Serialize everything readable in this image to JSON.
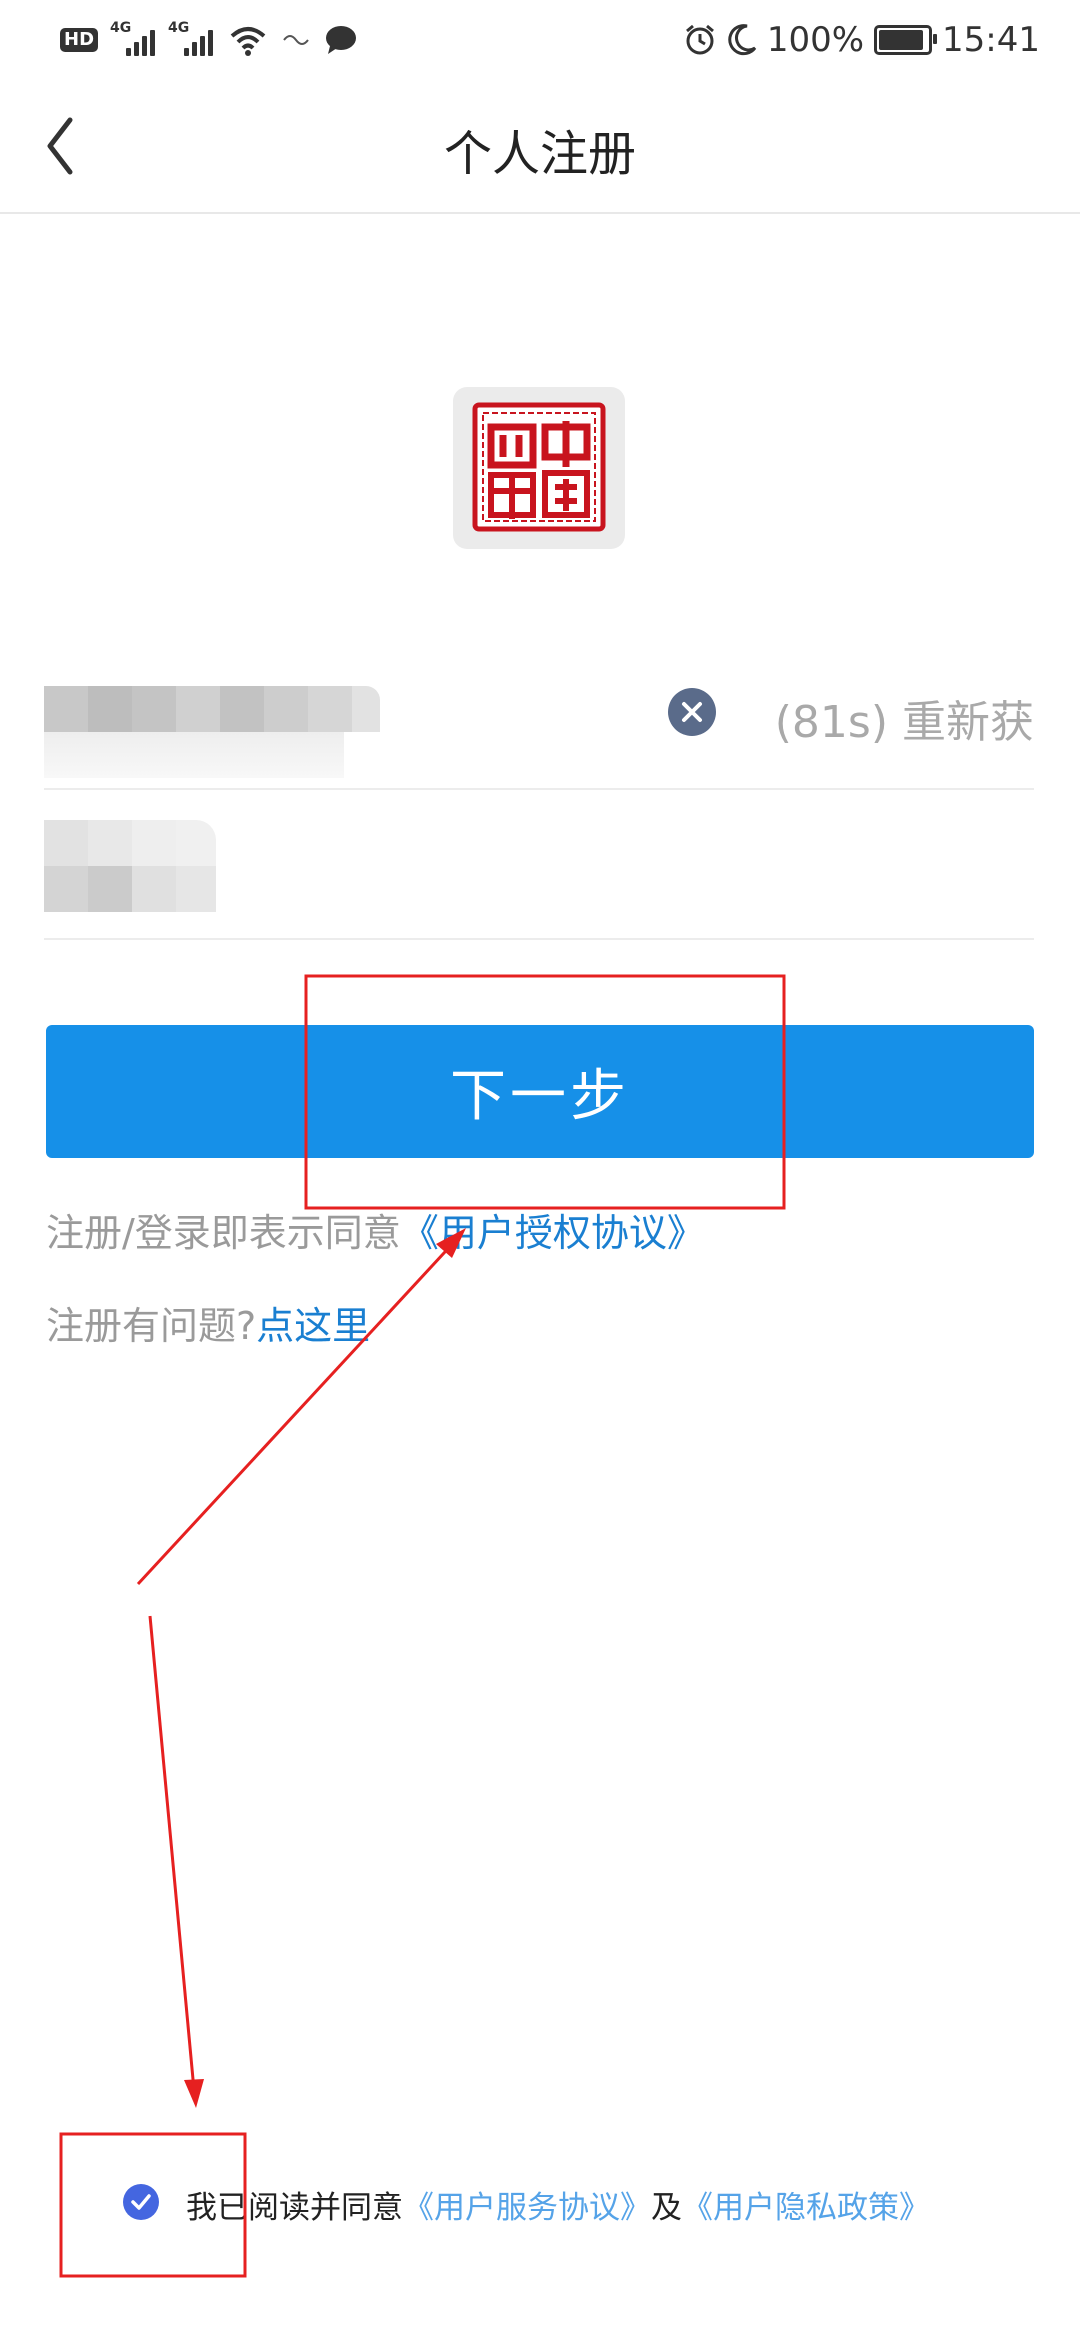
{
  "status_bar": {
    "left_badges": [
      "HD",
      "4G",
      "4G"
    ],
    "icons": [
      "hd-icon",
      "signal-icon",
      "signal-icon",
      "wifi-icon",
      "sync-icon",
      "message-icon"
    ],
    "battery_text": "100%",
    "battery_level": 1.0,
    "right_icons": [
      "alarm-icon",
      "moon-icon",
      "battery-icon"
    ],
    "time": "15:41"
  },
  "header": {
    "title": "个人注册",
    "back_icon": "chevron-left-icon"
  },
  "logo": {
    "description_icon": "red-seal-logo",
    "accent": "#c8141e",
    "text": "中國四東"
  },
  "form": {
    "resend_label": "(81s) 重新获",
    "clear_icon": "clear-circle-icon"
  },
  "actions": {
    "next_label": "下一步"
  },
  "agreement": {
    "prefix": "注册/登录即表示同意",
    "link": "《用户授权协议》"
  },
  "help": {
    "prefix": "注册有问题?",
    "link": "点这里"
  },
  "footer": {
    "checkbox_checked": true,
    "text_prefix": "我已阅读并同意",
    "service_link": "《用户服务协议》",
    "conjunction": "及",
    "privacy_link": "《用户隐私政策》"
  },
  "colors": {
    "primary_button": "#1690e8",
    "link": "#1a7fd1",
    "annotation_red": "#e62020"
  }
}
